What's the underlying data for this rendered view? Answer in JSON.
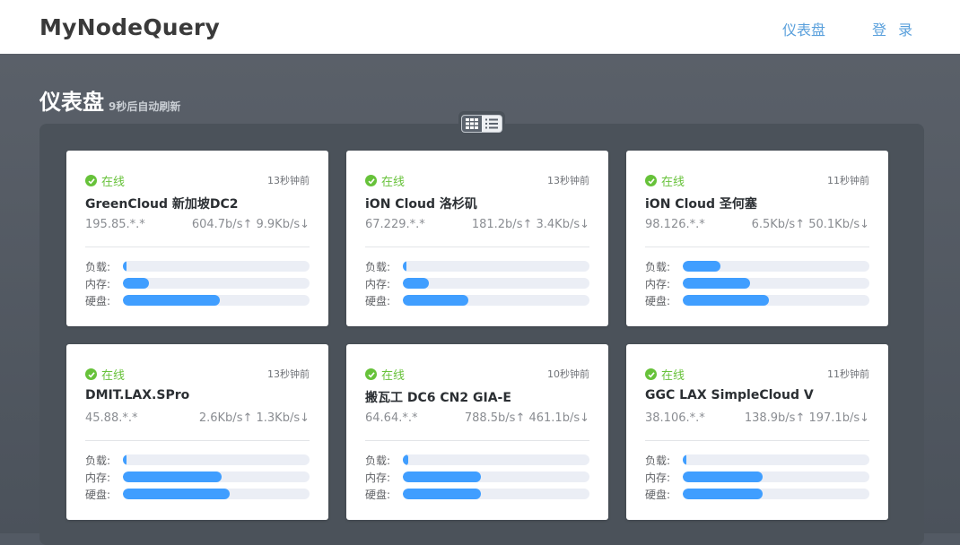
{
  "app": {
    "brand": "MyNodeQuery",
    "nav": {
      "dashboard": "仪表盘",
      "login": "登 录"
    }
  },
  "page": {
    "title": "仪表盘",
    "refresh_note": "9秒后自动刷新"
  },
  "labels": {
    "load": "负载:",
    "memory": "内存:",
    "disk": "硬盘:"
  },
  "colors": {
    "online": "#67c23a",
    "bar": "#409eff",
    "track": "#ebeef5",
    "link": "#5aa0dc"
  },
  "nodes": [
    {
      "status": "在线",
      "time": "13秒钟前",
      "name": "GreenCloud 新加坡DC2",
      "ip": "195.85.*.*",
      "speed": "604.7b/s↑ 9.9Kb/s↓",
      "load": 0.02,
      "memory": 0.14,
      "disk": 0.52
    },
    {
      "status": "在线",
      "time": "13秒钟前",
      "name": "iON Cloud 洛杉矶",
      "ip": "67.229.*.*",
      "speed": "181.2b/s↑ 3.4Kb/s↓",
      "load": 0.02,
      "memory": 0.14,
      "disk": 0.35
    },
    {
      "status": "在线",
      "time": "11秒钟前",
      "name": "iON Cloud 圣何塞",
      "ip": "98.126.*.*",
      "speed": "6.5Kb/s↑ 50.1Kb/s↓",
      "load": 0.2,
      "memory": 0.36,
      "disk": 0.46
    },
    {
      "status": "在线",
      "time": "13秒钟前",
      "name": "DMIT.LAX.SPro",
      "ip": "45.88.*.*",
      "speed": "2.6Kb/s↑ 1.3Kb/s↓",
      "load": 0.02,
      "memory": 0.53,
      "disk": 0.57
    },
    {
      "status": "在线",
      "time": "10秒钟前",
      "name": "搬瓦工 DC6 CN2 GIA-E",
      "ip": "64.64.*.*",
      "speed": "788.5b/s↑ 461.1b/s↓",
      "load": 0.03,
      "memory": 0.42,
      "disk": 0.42
    },
    {
      "status": "在线",
      "time": "11秒钟前",
      "name": "GGC LAX SimpleCloud V",
      "ip": "38.106.*.*",
      "speed": "138.9b/s↑ 197.1b/s↓",
      "load": 0.02,
      "memory": 0.43,
      "disk": 0.43
    }
  ]
}
